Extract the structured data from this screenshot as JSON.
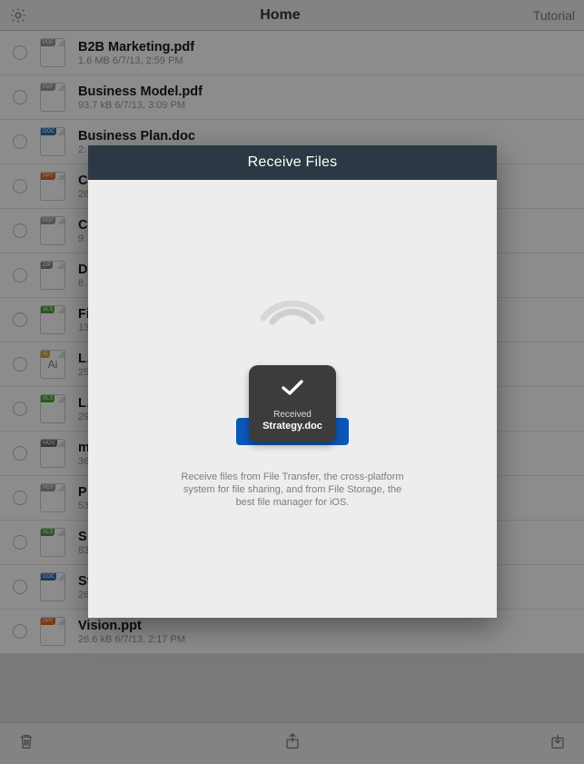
{
  "header": {
    "title": "Home",
    "rightlink": "Tutorial"
  },
  "files": [
    {
      "name": "B2B Marketing.pdf",
      "meta": "1.6 MB 6/7/13, 2:59 PM",
      "type": "pdf"
    },
    {
      "name": "Business Model.pdf",
      "meta": "93.7 kB 6/7/13, 3:09 PM",
      "type": "pdf"
    },
    {
      "name": "Business Plan.doc",
      "meta": "2…",
      "type": "doc"
    },
    {
      "name": "C…",
      "meta": "26…",
      "type": "ppt"
    },
    {
      "name": "C…",
      "meta": "9…",
      "type": "pdf"
    },
    {
      "name": "D…",
      "meta": "8…",
      "type": "zip"
    },
    {
      "name": "Fi…",
      "meta": "13…",
      "type": "xls"
    },
    {
      "name": "L…",
      "meta": "25…",
      "type": "ai"
    },
    {
      "name": "L…",
      "meta": "29…",
      "type": "xls"
    },
    {
      "name": "m…",
      "meta": "36…",
      "type": "mov"
    },
    {
      "name": "P…",
      "meta": "53…",
      "type": "pdf"
    },
    {
      "name": "S…",
      "meta": "83…",
      "type": "xls"
    },
    {
      "name": "St…",
      "meta": "26…",
      "type": "doc"
    },
    {
      "name": "Vision.ppt",
      "meta": "26.6 kB 6/7/13, 2:17 PM",
      "type": "ppt"
    }
  ],
  "modal": {
    "title": "Receive Files",
    "toast_line1": "Received",
    "toast_line2": "Strategy.doc",
    "description": "Receive files from File Transfer, the cross-platform system for file sharing, and from File Storage, the best file manager for iOS."
  }
}
